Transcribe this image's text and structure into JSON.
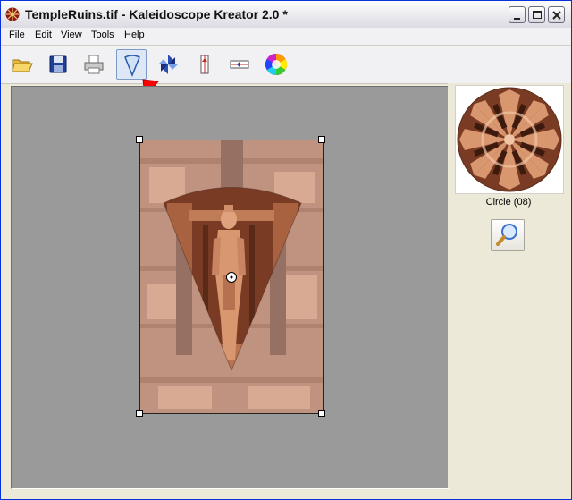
{
  "window": {
    "title": "TempleRuins.tif - Kaleidoscope Kreator 2.0 *",
    "app_icon": "kaleidoscope-app-icon",
    "controls": [
      "minimize-icon",
      "maximize-icon",
      "close-icon"
    ]
  },
  "menu": {
    "items": [
      {
        "label": "File"
      },
      {
        "label": "Edit"
      },
      {
        "label": "View"
      },
      {
        "label": "Tools"
      },
      {
        "label": "Help"
      }
    ]
  },
  "toolbar": {
    "tools": [
      {
        "name": "open-folder",
        "icon": "open-folder-icon"
      },
      {
        "name": "save",
        "icon": "floppy-disk-icon"
      },
      {
        "name": "print",
        "icon": "printer-icon"
      },
      {
        "name": "wedge-shape",
        "icon": "wedge-shape-icon",
        "active": true
      },
      {
        "name": "pinwheel",
        "icon": "pinwheel-icon"
      },
      {
        "name": "vertical-mirror",
        "icon": "vertical-mirror-icon"
      },
      {
        "name": "horizontal-mirror",
        "icon": "horizontal-mirror-icon"
      },
      {
        "name": "color-wheel",
        "icon": "color-wheel-icon"
      }
    ],
    "pointer_arrow_color": "#ff0000"
  },
  "canvas": {
    "background": "#9a9a9a",
    "image_label": "TempleRuins.tif",
    "selection": "wedge"
  },
  "preview": {
    "label": "Circle (08)",
    "zoom_icon": "magnifier-icon"
  },
  "colors": {
    "accent": "#7d9bc9",
    "title_bar_close": "#c84a3a",
    "stone": "#b06b4e"
  }
}
